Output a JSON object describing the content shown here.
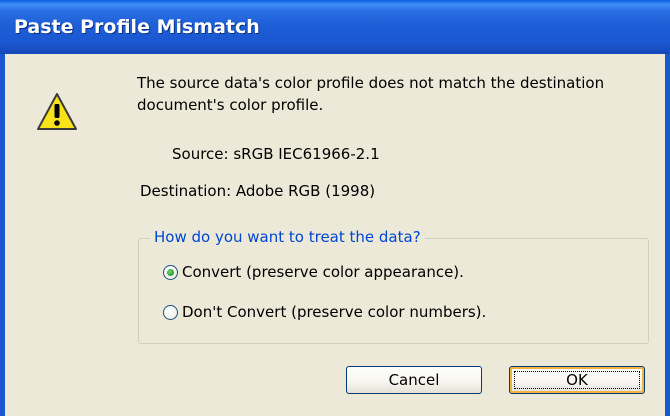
{
  "dialog": {
    "title": "Paste Profile Mismatch",
    "message_line1": "The source data's color profile does not match the destination",
    "message_line2": "document's color profile.",
    "source_label": "Source: sRGB IEC61966-2.1",
    "destination_label": "Destination: Adobe RGB (1998)",
    "icon": "warning-icon"
  },
  "group": {
    "legend": "How do you want to treat the data?",
    "options": [
      {
        "label": "Convert (preserve color appearance).",
        "selected": true
      },
      {
        "label": "Don't Convert (preserve color numbers).",
        "selected": false
      }
    ]
  },
  "buttons": {
    "cancel_label": "Cancel",
    "ok_label": "OK"
  },
  "colors": {
    "titlebar": "#1A57D0",
    "dialog_bg": "#ECE9D8",
    "legend_text": "#0046D5",
    "warning_fill": "#F7E21B"
  }
}
